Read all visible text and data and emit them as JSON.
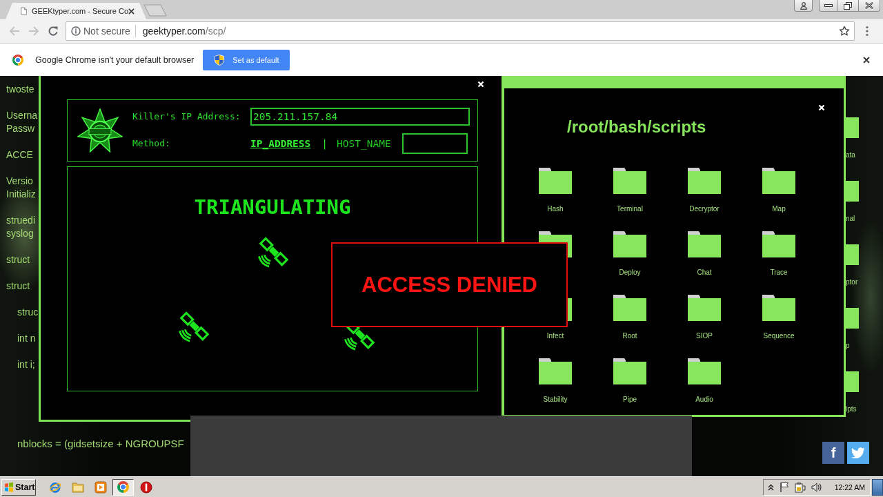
{
  "browser": {
    "tabs": [
      {
        "title": "GEEKtyper.com - Secure Co",
        "selected": true
      }
    ],
    "toolbar": {
      "back": {
        "disabled": true
      },
      "forward": {
        "disabled": true
      }
    },
    "address": {
      "security": "Not secure",
      "host": "geektyper.com",
      "path": "/scp/"
    },
    "infobar": {
      "message": "Google Chrome isn't your default browser",
      "button": "Set as default"
    }
  },
  "page": {
    "background_code": {
      "blocks": [
        {
          "paragraphs": [
            {
              "lines": [
                "twoste"
              ]
            },
            {
              "lines": [
                "Userna",
                "Passw"
              ]
            }
          ]
        },
        {
          "paragraphs": [
            {
              "lines": [
                "ACCE"
              ]
            },
            {
              "lines": [
                "Versio",
                "Initializ"
              ]
            },
            {
              "lines": [
                "struedi",
                "syslog"
              ]
            },
            {
              "lines": [
                "struct"
              ]
            },
            {
              "lines": [
                "struct"
              ],
              "children": [
                {
                  "lines": [
                    "struc"
                  ]
                },
                {
                  "lines": [
                    "int n"
                  ]
                },
                {
                  "lines": [
                    "int i;"
                  ]
                }
              ]
            }
          ]
        }
      ],
      "last_line": "nblocks = (gidsetsize + NGROUPSF"
    },
    "side_icons": [
      {
        "label": "ata"
      },
      {
        "label": "nal"
      },
      {
        "label": "ptor"
      },
      {
        "label": "p"
      },
      {
        "label": "ipts"
      }
    ],
    "trace_window": {
      "ip_label": "Killer's IP Address:",
      "ip_value": "205.211.157.84",
      "method_label": "Method:",
      "methods": [
        {
          "label": "IP_ADDRESS",
          "selected": true
        },
        {
          "label": "HOST_NAME",
          "selected": false
        }
      ],
      "separator": "|",
      "status": "TRIANGULATING"
    },
    "scripts_window": {
      "title": "/root/bash/scripts",
      "folders": [
        {
          "kind": "labeled",
          "label": "Hash"
        },
        {
          "kind": "labeled",
          "label": "Terminal"
        },
        {
          "kind": "labeled",
          "label": "Decryptor"
        },
        {
          "kind": "labeled",
          "label": "Map"
        },
        {
          "kind": "plain"
        },
        {
          "kind": "labeled",
          "label": "Deploy"
        },
        {
          "kind": "labeled",
          "label": "Chat"
        },
        {
          "kind": "labeled",
          "label": "Trace"
        },
        {
          "kind": "labeled",
          "label": "Infect"
        },
        {
          "kind": "labeled",
          "label": "Root"
        },
        {
          "kind": "labeled",
          "label": "SIOP"
        },
        {
          "kind": "labeled",
          "label": "Sequence"
        },
        {
          "kind": "labeled",
          "label": "Stability"
        },
        {
          "kind": "labeled",
          "label": "Pipe"
        },
        {
          "kind": "labeled",
          "label": "Audio"
        }
      ]
    },
    "alert": {
      "text": "ACCESS DENIED"
    },
    "share_buttons": [
      {
        "kind": "facebook",
        "glyph": "f"
      },
      {
        "kind": "twitter"
      }
    ]
  },
  "taskbar": {
    "start": "Start",
    "apps": [
      {
        "kind": "ie",
        "selected": false
      },
      {
        "kind": "explorer",
        "selected": false
      },
      {
        "kind": "media",
        "selected": false
      },
      {
        "kind": "chrome",
        "selected": true
      },
      {
        "kind": "stop",
        "selected": false
      }
    ],
    "clock": "12:22 AM"
  }
}
